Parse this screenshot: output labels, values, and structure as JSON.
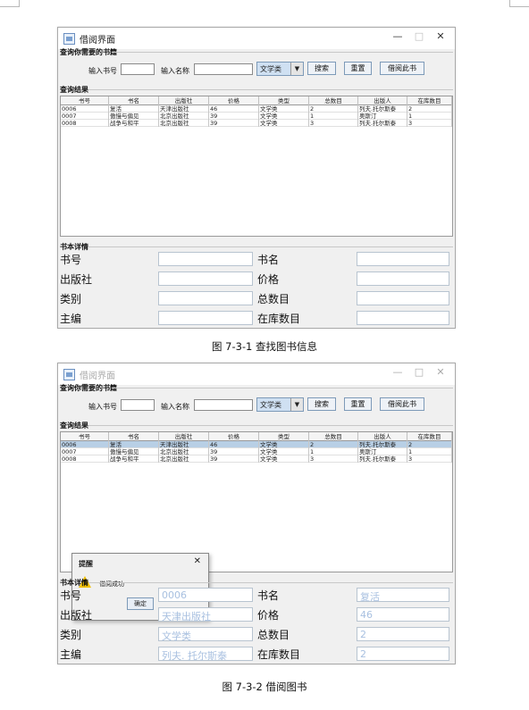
{
  "window": {
    "title": "借阅界面",
    "min": "—",
    "max": "□",
    "close": "✕"
  },
  "search": {
    "group_title": "查询你需要的书籍",
    "book_id_label": "输入书号",
    "name_label": "输入名称",
    "category": "文学类",
    "search_btn": "搜索",
    "reset_btn": "重置",
    "borrow_btn": "借阅此书"
  },
  "results": {
    "group_title": "查询结果",
    "headers": [
      "书号",
      "书名",
      "出版社",
      "价格",
      "类型",
      "总数目",
      "出版人",
      "在库数目"
    ],
    "screen1_rows": [
      [
        "0006",
        "复活",
        "天津出版社",
        "46",
        "文学类",
        "2",
        "列夫.托尔斯泰",
        "2"
      ],
      [
        "0007",
        "傲慢与偏见",
        "北京出版社",
        "39",
        "文学类",
        "1",
        "奥斯汀",
        "1"
      ],
      [
        "0008",
        "战争与和平",
        "北京出版社",
        "39",
        "文学类",
        "3",
        "列夫.托尔斯泰",
        "3"
      ]
    ],
    "screen2_rows": [
      [
        "0006",
        "复活",
        "天津出版社",
        "46",
        "文学类",
        "2",
        "列夫.托尔斯泰",
        "2"
      ],
      [
        "0007",
        "傲慢与偏见",
        "北京出版社",
        "39",
        "文学类",
        "1",
        "奥斯汀",
        "1"
      ],
      [
        "0008",
        "战争与和平",
        "北京出版社",
        "39",
        "文学类",
        "3",
        "列夫.托尔斯泰",
        "3"
      ]
    ]
  },
  "details": {
    "group_title": "书本详情",
    "labels": [
      "书号",
      "书名",
      "出版社",
      "价格",
      "类别",
      "总数目",
      "主编",
      "在库数目"
    ],
    "screen2_values": [
      "0006",
      "复活",
      "天津出版社",
      "46",
      "文学类",
      "2",
      "列夫. 托尔斯泰",
      "2"
    ]
  },
  "dialog": {
    "title": "提醒",
    "close": "✕",
    "icon_mark": "!",
    "message": "借阅成功",
    "ok": "确定"
  },
  "captions": {
    "fig1": "图 7-3-1 查找图书信息",
    "fig2": "图 7-3-2 借阅图书"
  }
}
